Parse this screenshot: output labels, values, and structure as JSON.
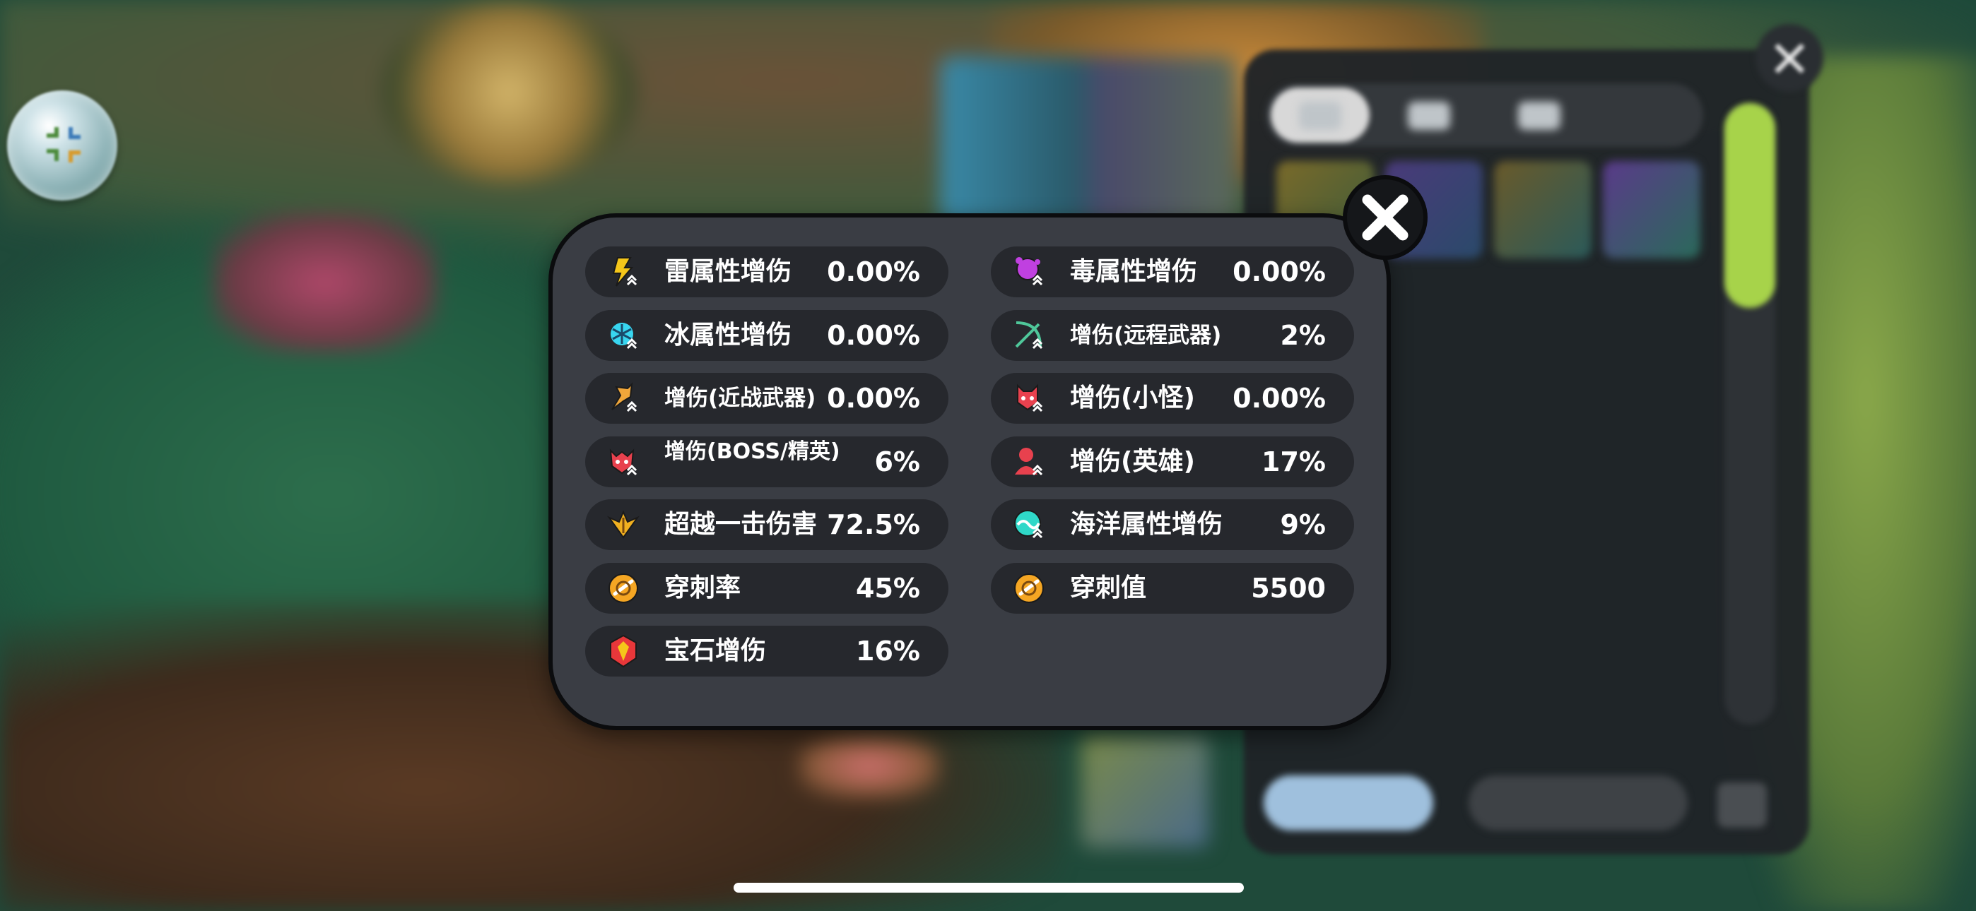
{
  "stats_panel": {
    "left_column": [
      {
        "label": "雷属性增伤",
        "value": "0.00%",
        "icon": "lightning-icon",
        "icon_color": "#f5c61a"
      },
      {
        "label": "冰属性增伤",
        "value": "0.00%",
        "icon": "snowflake-icon",
        "icon_color": "#38d6f0"
      },
      {
        "label": "增伤(近战武器)",
        "value": "0.00%",
        "icon": "melee-weapon-icon",
        "icon_color": "#f0a63a"
      },
      {
        "label": "增伤(BOSS/精英)",
        "value": "6%",
        "icon": "boss-elite-icon",
        "icon_color": "#e8414e"
      },
      {
        "label": "超越一击伤害",
        "value": "72.5%",
        "icon": "transcend-strike-icon",
        "icon_color": "#f0b020"
      },
      {
        "label": "穿刺率",
        "value": "45%",
        "icon": "pierce-rate-icon",
        "icon_color": "#f5a623"
      },
      {
        "label": "宝石增伤",
        "value": "16%",
        "icon": "gem-icon",
        "icon_color": "#e8373a"
      }
    ],
    "right_column": [
      {
        "label": "毒属性增伤",
        "value": "0.00%",
        "icon": "poison-icon",
        "icon_color": "#c040e0"
      },
      {
        "label": "增伤(远程武器)",
        "value": "2%",
        "icon": "ranged-weapon-icon",
        "icon_color": "#4fc79a"
      },
      {
        "label": "增伤(小怪)",
        "value": "0.00%",
        "icon": "minion-icon",
        "icon_color": "#e8414e"
      },
      {
        "label": "增伤(英雄)",
        "value": "17%",
        "icon": "hero-icon",
        "icon_color": "#e8414e"
      },
      {
        "label": "海洋属性增伤",
        "value": "9%",
        "icon": "ocean-icon",
        "icon_color": "#2fd8c8"
      },
      {
        "label": "穿刺值",
        "value": "5500",
        "icon": "pierce-value-icon",
        "icon_color": "#f5a623"
      }
    ],
    "close_icon": "close-icon"
  },
  "colors": {
    "panel_bg": "#3a3d44",
    "pill_bg": "#26282d",
    "text": "#ffffff",
    "outline": "#0b0c0e",
    "scroll_accent": "#a7d34a"
  }
}
